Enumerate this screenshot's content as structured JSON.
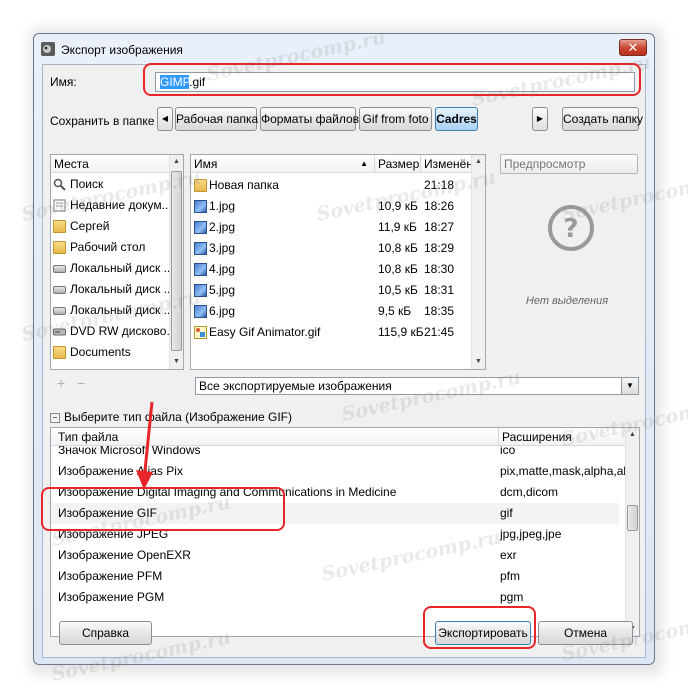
{
  "window": {
    "title": "Экспорт изображения",
    "close_glyph": "✕"
  },
  "name_field": {
    "label": "Имя:",
    "value_selected": "GIMP",
    "value_rest": ".gif"
  },
  "save_in": {
    "label": "Сохранить в папке",
    "breadcrumbs": [
      "Рабочая папка",
      "Форматы файлов",
      "Gif from foto",
      "Cadres"
    ],
    "active_index": 3,
    "create_folder": "Создать папку"
  },
  "places": {
    "header": "Места",
    "items": [
      {
        "label": "Поиск",
        "icon": "search-icon"
      },
      {
        "label": "Недавние докум...",
        "icon": "recent-icon"
      },
      {
        "label": "Сергей",
        "icon": "folder-icon"
      },
      {
        "label": "Рабочий стол",
        "icon": "folder-icon"
      },
      {
        "label": "Локальный диск ...",
        "icon": "drive-icon"
      },
      {
        "label": "Локальный диск ...",
        "icon": "drive-icon"
      },
      {
        "label": "Локальный диск ...",
        "icon": "drive-icon"
      },
      {
        "label": "DVD RW дисково...",
        "icon": "dvd-icon"
      },
      {
        "label": "Documents",
        "icon": "folder-icon"
      }
    ],
    "add_glyph": "+",
    "remove_glyph": "−"
  },
  "files": {
    "columns": {
      "name": "Имя",
      "size": "Размер",
      "modified": "Изменён"
    },
    "rows": [
      {
        "name": "Новая папка",
        "size": "",
        "modified": "21:18",
        "icon": "folder-icon"
      },
      {
        "name": "1.jpg",
        "size": "10,9 кБ",
        "modified": "18:26",
        "icon": "image-icon"
      },
      {
        "name": "2.jpg",
        "size": "11,9 кБ",
        "modified": "18:27",
        "icon": "image-icon"
      },
      {
        "name": "3.jpg",
        "size": "10,8 кБ",
        "modified": "18:29",
        "icon": "image-icon"
      },
      {
        "name": "4.jpg",
        "size": "10,8 кБ",
        "modified": "18:30",
        "icon": "image-icon"
      },
      {
        "name": "5.jpg",
        "size": "10,5 кБ",
        "modified": "18:31",
        "icon": "image-icon"
      },
      {
        "name": "6.jpg",
        "size": "9,5 кБ",
        "modified": "18:35",
        "icon": "image-icon"
      },
      {
        "name": "Easy Gif Animator.gif",
        "size": "115,9 кБ",
        "modified": "21:45",
        "icon": "gif-icon"
      }
    ],
    "filter_value": "Все экспортируемые изображения"
  },
  "preview": {
    "title": "Предпросмотр",
    "empty_text": "Нет выделения",
    "glyph": "?"
  },
  "file_type": {
    "expander_label": "Выберите тип файла (Изображение GIF)",
    "columns": {
      "type": "Тип файла",
      "ext": "Расширения"
    },
    "rows": [
      {
        "type": "Значок Microsoft Windows",
        "ext": "ico"
      },
      {
        "type": "Изображение Alias Pix",
        "ext": "pix,matte,mask,alpha,als"
      },
      {
        "type": "Изображение Digital Imaging and Communications in Medicine",
        "ext": "dcm,dicom"
      },
      {
        "type": "Изображение GIF",
        "ext": "gif"
      },
      {
        "type": "Изображение JPEG",
        "ext": "jpg,jpeg,jpe"
      },
      {
        "type": "Изображение OpenEXR",
        "ext": "exr"
      },
      {
        "type": "Изображение PFM",
        "ext": "pfm"
      },
      {
        "type": "Изображение PGM",
        "ext": "pgm"
      }
    ],
    "selected_index": 3
  },
  "buttons": {
    "help": "Справка",
    "export": "Экспортировать",
    "cancel": "Отмена"
  },
  "watermark_text": "Sovetprocomp.ru",
  "colors": {
    "highlight_red": "#e8262a",
    "selection_blue": "#3399ff"
  }
}
